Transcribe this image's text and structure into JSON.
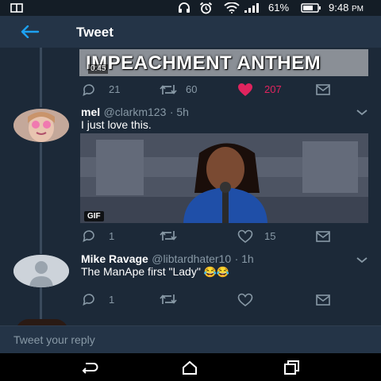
{
  "status_bar": {
    "battery_percent": "61%",
    "time": "9:48",
    "ampm": "PM"
  },
  "app_bar": {
    "title": "Tweet"
  },
  "previous_tweet": {
    "media_caption": "IMPEACHMENT ANTHEM",
    "media_time": "0:45",
    "reply_count": "21",
    "retweet_count": "60",
    "like_count": "207",
    "liked": true
  },
  "tweets": [
    {
      "name": "mel",
      "handle": "@clarkm123",
      "time": "· 5h",
      "text": "I just love this.",
      "media_badge": "GIF",
      "reply_count": "1",
      "retweet_count": "",
      "like_count": "15"
    },
    {
      "name": "Mike Ravage",
      "handle": "@libtardhater10",
      "time": "· 1h",
      "text": "The ManApe first \"Lady\"",
      "emoji": "😂😂",
      "reply_count": "1",
      "retweet_count": "",
      "like_count": ""
    }
  ],
  "reply_bar": {
    "placeholder": "Tweet your reply"
  },
  "colors": {
    "background": "#1c2938",
    "accent": "#1da1f2",
    "like": "#e0245e",
    "muted": "#8899a6"
  }
}
